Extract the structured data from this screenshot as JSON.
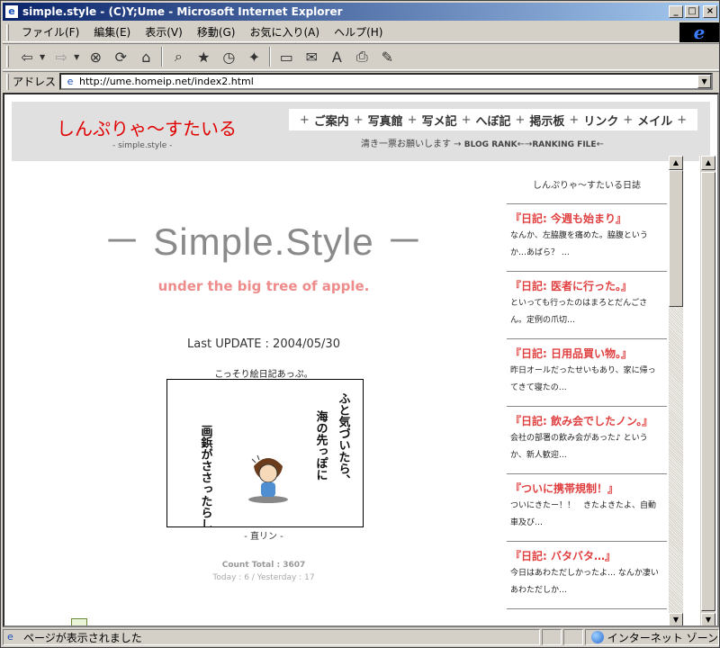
{
  "window": {
    "title": "simple.style - (C)Y;Ume - Microsoft Internet Explorer",
    "ctrl_min": "_",
    "ctrl_max": "□",
    "ctrl_close": "×"
  },
  "menu": [
    "ファイル(F)",
    "編集(E)",
    "表示(V)",
    "移動(G)",
    "お気に入り(A)",
    "ヘルプ(H)"
  ],
  "address": {
    "label": "アドレス",
    "url": "http://ume.homeip.net/index2.html"
  },
  "site": {
    "title": "しんぷりゃ～すたいる",
    "subtitle": "- simple.style -",
    "nav": [
      "ご案内",
      "写真館",
      "写メ記",
      "へぼ記",
      "掲示板",
      "リンク",
      "メイル"
    ],
    "nav_sep": "+",
    "rank_prefix": "清き一票お願いします →",
    "rank_blog": "BLOG RANK",
    "rank_mid": "←→",
    "rank_file": "RANKING FILE",
    "rank_suffix": "←"
  },
  "main": {
    "hero_title": "－ Simple.Style －",
    "hero_subtitle": "under the big tree of apple.",
    "last_update": "Last UPDATE : 2004/05/30",
    "comic_caption": "こっそり絵日記あっぷ。",
    "comic_line1": "ふと気づいたら、",
    "comic_line2": "海の先っぽに",
    "comic_line3": "画鋲がささったらしい。",
    "comic_credit": "- 直リン -",
    "count_total": "Count Total : 3607",
    "count_sub": "Today : 6 / Yesterday : 17"
  },
  "sidebar": {
    "heading": "しんぷりゃ～すたいる日誌",
    "entries": [
      {
        "title": "『日記: 今週も始まり』",
        "text": "なんか、左脇腹を痛めた。脇腹というか…あばら？ …"
      },
      {
        "title": "『日記: 医者に行った。』",
        "text": "といっても行ったのはまろとだんごさん。定例の爪切…"
      },
      {
        "title": "『日記: 日用品買い物。』",
        "text": "昨日オールだったせいもあり、家に帰ってきて寝たの…"
      },
      {
        "title": "『日記: 飲み会でしたノン。』",
        "text": "会社の部署の飲み会があった♪ というか、新人歓迎…"
      },
      {
        "title": "『ついに携帯規制！』",
        "text": "ついにきたー！！　きたよきたよ、自動車及び…"
      },
      {
        "title": "『日記: バタバタ…』",
        "text": "今日はあわただしかったよ… なんか凄いあわただしか…"
      }
    ]
  },
  "status": {
    "text": "ページが表示されました",
    "zone": "インターネット ゾーン"
  }
}
